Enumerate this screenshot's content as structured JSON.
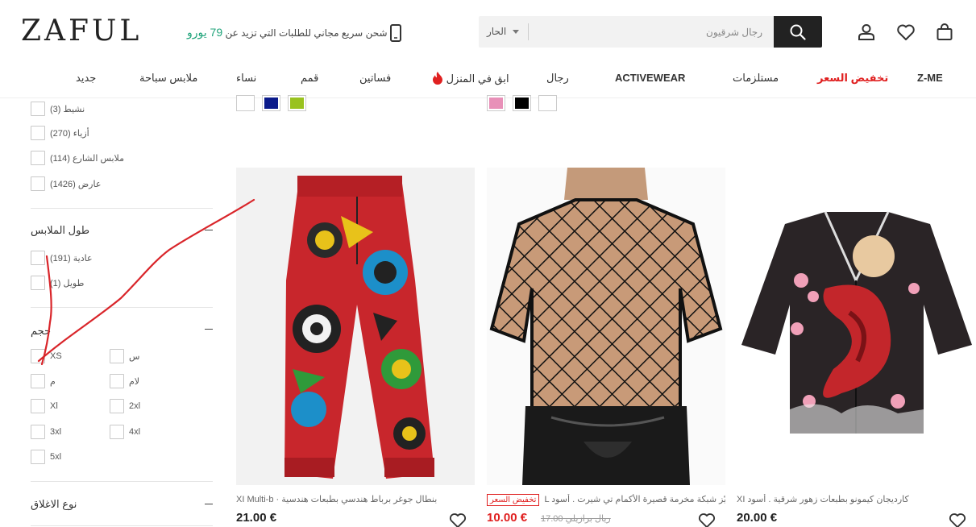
{
  "header": {
    "logo": "ZAFUL",
    "shipping_text": "شحن سريع مجاني للطلبات التي تزيد عن",
    "shipping_amount": "79 يورو",
    "search": {
      "category": "الحار",
      "placeholder": "رجال شرقيون"
    }
  },
  "nav": {
    "items": [
      "Z-ME",
      "تخفيض السعر",
      "مستلزمات",
      "ACTIVEWEAR",
      "رجال",
      "ابق في المنزل",
      "فساتين",
      "قمم",
      "نساء",
      "ملابس سباحة",
      "جديد"
    ]
  },
  "sidebar": {
    "style_options": [
      "نشيط (3)",
      "أزياء (270)",
      "ملابس الشارع (114)",
      "عارض (1426)"
    ],
    "length_title": "طول الملابس",
    "length_options": [
      "عادية (191)",
      "طويل (1)"
    ],
    "size_title": "حجم",
    "size_options": [
      "XS",
      "س",
      "م",
      "لام",
      "Xl",
      "2xl",
      "3xl",
      "4xl",
      "5xl"
    ],
    "closure_title": "نوع الاغلاق"
  },
  "swatches": {
    "left": [
      "#ffffff",
      "#0a1a8a",
      "#99c21f"
    ],
    "right": [
      "#e890b8",
      "#000000",
      "#ffffff"
    ]
  },
  "products": [
    {
      "title": "XI Multi-b · بنطال جوغر برباط هندسي بطبعات هندسية",
      "price": "21.00 €"
    },
    {
      "badge": "تخفيض السعر",
      "title": "L ميّز شبكة مخرمة قصيرة الأكمام تي شيرت . أسود",
      "price": "10.00 €",
      "old_price": "ريال برازيلي 17.00"
    },
    {
      "title": "XI كارديجان كيمونو بطبعات زهور شرقية . أسود",
      "price": "20.00 €"
    }
  ],
  "colors": {
    "accent_red": "#e02020",
    "promo_green": "#1fa37a",
    "dark": "#222222"
  }
}
